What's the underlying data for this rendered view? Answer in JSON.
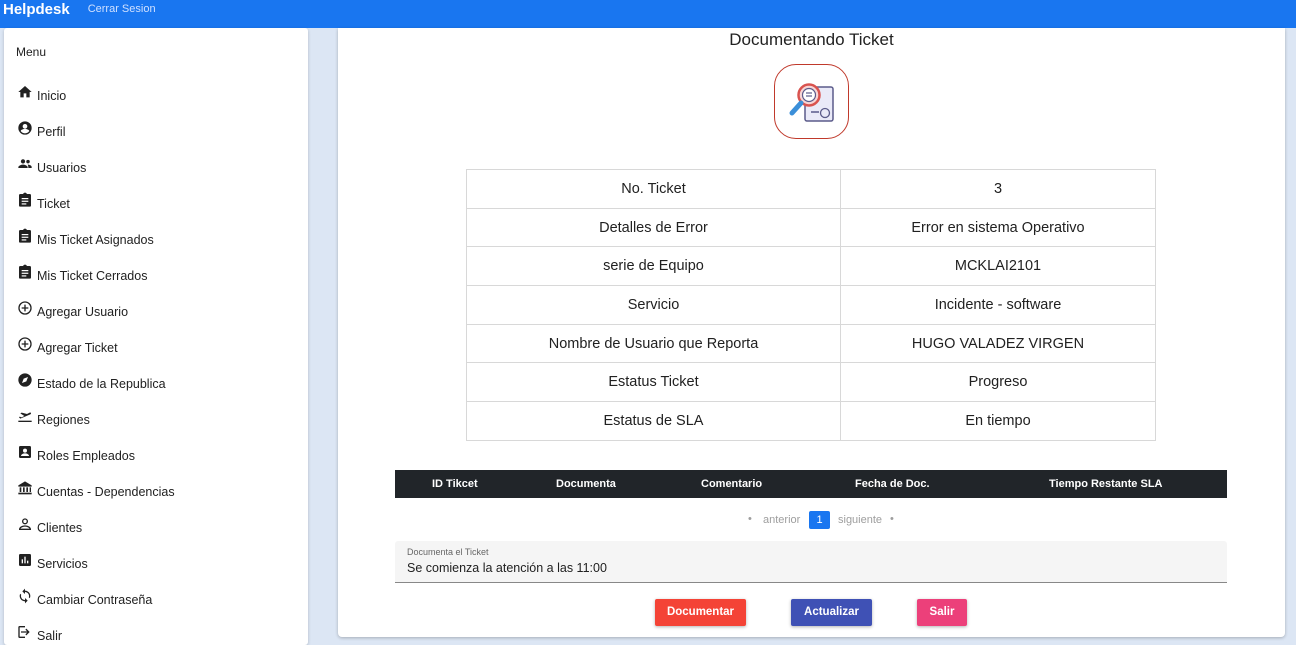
{
  "app": {
    "brand": "Helpdesk",
    "logout_label": "Cerrar Sesion"
  },
  "sidebar": {
    "title": "Menu",
    "items": [
      {
        "label": "Inicio",
        "icon": "home-icon"
      },
      {
        "label": "Perfil",
        "icon": "account-circle-icon"
      },
      {
        "label": "Usuarios",
        "icon": "people-icon"
      },
      {
        "label": "Ticket",
        "icon": "clipboard-icon"
      },
      {
        "label": "Mis Ticket Asignados",
        "icon": "clipboard-icon"
      },
      {
        "label": "Mis Ticket Cerrados",
        "icon": "clipboard-icon"
      },
      {
        "label": "Agregar Usuario",
        "icon": "add-circle-icon"
      },
      {
        "label": "Agregar Ticket",
        "icon": "add-circle-icon"
      },
      {
        "label": "Estado de la Republica",
        "icon": "compass-icon"
      },
      {
        "label": "Regiones",
        "icon": "flight-takeoff-icon"
      },
      {
        "label": "Roles Empleados",
        "icon": "contact-badge-icon"
      },
      {
        "label": "Cuentas - Dependencias",
        "icon": "bank-icon"
      },
      {
        "label": "Clientes",
        "icon": "person-outline-icon"
      },
      {
        "label": "Servicios",
        "icon": "bar-chart-icon"
      },
      {
        "label": "Cambiar Contraseña",
        "icon": "sync-icon"
      },
      {
        "label": "Salir",
        "icon": "logout-icon"
      }
    ]
  },
  "main": {
    "title": "Documentando Ticket",
    "logo_icon": "ticket-search-icon",
    "details": [
      {
        "key": "No. Ticket",
        "value": "3"
      },
      {
        "key": "Detalles de Error",
        "value": "Error en sistema Operativo"
      },
      {
        "key": "serie de Equipo",
        "value": "MCKLAI2101"
      },
      {
        "key": "Servicio",
        "value": "Incidente - software"
      },
      {
        "key": "Nombre de Usuario que Reporta",
        "value": "HUGO VALADEZ VIRGEN"
      },
      {
        "key": "Estatus Ticket",
        "value": "Progreso"
      },
      {
        "key": "Estatus de SLA",
        "value": "En tiempo"
      }
    ],
    "table": {
      "columns": [
        "ID Tikcet",
        "Documenta",
        "Comentario",
        "Fecha de Doc.",
        "Tiempo Restante SLA"
      ]
    },
    "pagination": {
      "prev": "anterior",
      "page": "1",
      "next": "siguiente"
    },
    "document_field": {
      "label": "Documenta el Ticket",
      "value": "Se comienza la atención a las 11:00"
    },
    "buttons": {
      "document": "Documentar",
      "update": "Actualizar",
      "exit": "Salir"
    }
  },
  "colors": {
    "primary": "#1976f0",
    "danger": "#f44336",
    "indigo": "#3f51b5",
    "pink": "#ec407a"
  }
}
